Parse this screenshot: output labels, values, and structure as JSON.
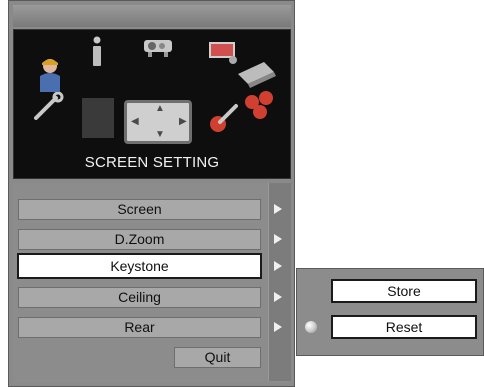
{
  "panel": {
    "title": "SCREEN SETTING"
  },
  "menu": {
    "items": [
      {
        "label": "Screen",
        "selected": false
      },
      {
        "label": "D.Zoom",
        "selected": false
      },
      {
        "label": "Keystone",
        "selected": true
      },
      {
        "label": "Ceiling",
        "selected": false
      },
      {
        "label": "Rear",
        "selected": false
      }
    ],
    "quit_label": "Quit"
  },
  "submenu": {
    "items": [
      {
        "label": "Store"
      },
      {
        "label": "Reset"
      }
    ]
  },
  "icons": [
    "operator-icon",
    "info-icon",
    "projector-icon",
    "screen-small-icon",
    "laptop-balls-icon",
    "wrench-icon",
    "dark-square-icon",
    "screen-setting-icon",
    "tools-icon"
  ]
}
